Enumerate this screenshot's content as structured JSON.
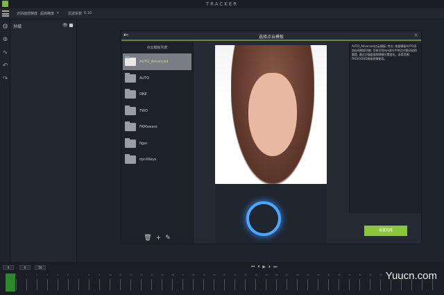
{
  "app": {
    "title": "TRACKER"
  },
  "toolbar": {
    "precision_label": "识别面部精度",
    "precision_value": "超高精度",
    "filter_label": "滤波系数",
    "filter_value": "0.10"
  },
  "group_panel": {
    "title": "分组"
  },
  "modal": {
    "title": "选择点云模板",
    "list_header": "点云模板列表",
    "items": [
      {
        "label": "AUTO_Advanced"
      },
      {
        "label": "AUTO"
      },
      {
        "label": "ONE"
      },
      {
        "label": "TWO"
      },
      {
        "label": "FKMaware"
      },
      {
        "label": "figer"
      },
      {
        "label": "dynXKeys"
      }
    ],
    "description": "AUTO_Advanced点云模板: 特点: 依据模板AUTO添加自动眼部功能, 目前识别eye部分中的点对眼动追踪跟踪, 通过大幅度追踪眼睛位置变化。适用范围: FACEGOOD高级表情使用。",
    "done_label": "设置完成"
  },
  "timeline": {
    "fields": [
      "0",
      "0",
      "50"
    ],
    "frames": [
      "1",
      "2",
      "3",
      "4",
      "5",
      "6",
      "7",
      "8",
      "9",
      "10",
      "11",
      "12",
      "13",
      "14",
      "15",
      "16",
      "17",
      "18",
      "19",
      "20",
      "21",
      "22",
      "23",
      "24",
      "25",
      "26",
      "27",
      "28",
      "29",
      "30",
      "31",
      "32",
      "33",
      "34",
      "35",
      "36",
      "37",
      "38",
      "39",
      "40",
      "41"
    ]
  },
  "watermark": "Yuucn.com",
  "colors": {
    "accent": "#8cc63f",
    "timeline_cursor": "#2a8a2a"
  }
}
